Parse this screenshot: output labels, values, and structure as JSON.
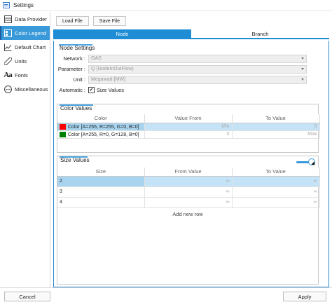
{
  "window": {
    "title": "Settings"
  },
  "sidebar": {
    "items": [
      {
        "label": "Data Provider",
        "icon": "data-provider-icon",
        "active": false
      },
      {
        "label": "Color Legend",
        "icon": "color-legend-icon",
        "active": true
      },
      {
        "label": "Default Chart",
        "icon": "chart-icon",
        "active": false
      },
      {
        "label": "Units",
        "icon": "ruler-icon",
        "active": false
      },
      {
        "label": "Fonts",
        "icon": "fonts-icon",
        "active": false
      },
      {
        "label": "Miscellaneous",
        "icon": "ellipsis-icon",
        "active": false
      }
    ]
  },
  "toolbar": {
    "load_label": "Load File",
    "save_label": "Save File"
  },
  "tabs": [
    {
      "label": "Node",
      "active": true
    },
    {
      "label": "Branch",
      "active": false
    }
  ],
  "node_settings": {
    "title": "Node Settings",
    "network_label": "Network :",
    "network_value": "GAS",
    "parameter_label": "Parameter :",
    "parameter_value": "Q (NodeInOutFlow)",
    "unit_label": "Unit :",
    "unit_value": "Megawatt-[MW]",
    "automatic_label": "Automatic :",
    "size_values_label": "Size Values",
    "size_values_checked": true
  },
  "color_values": {
    "title": "Color Values",
    "headers": [
      "Color",
      "Value From",
      "To Value"
    ],
    "rows": [
      {
        "color_label": "Color [A=255, R=255, G=0, B=0]",
        "swatch": "#ff0000",
        "from": "Min",
        "to": "0",
        "selected": true
      },
      {
        "color_label": "Color [A=255, R=0, G=128, B=0]",
        "swatch": "#008000",
        "from": "0",
        "to": "Max",
        "selected": false
      }
    ]
  },
  "size_values": {
    "title": "Size Values",
    "headers": [
      "Size",
      "From Value",
      "To Value"
    ],
    "rows": [
      {
        "size": "2",
        "from": "∞",
        "to": "∞",
        "selected": true
      },
      {
        "size": "3",
        "from": "∞",
        "to": "∞",
        "selected": false
      },
      {
        "size": "4",
        "from": "∞",
        "to": "∞",
        "selected": false
      }
    ],
    "add_row_label": "Add new row",
    "toggle_on": true
  },
  "footer": {
    "cancel_label": "Cancel",
    "apply_label": "Apply"
  },
  "colors": {
    "accent": "#1f8dd6",
    "selection": "#c5e3f7"
  }
}
